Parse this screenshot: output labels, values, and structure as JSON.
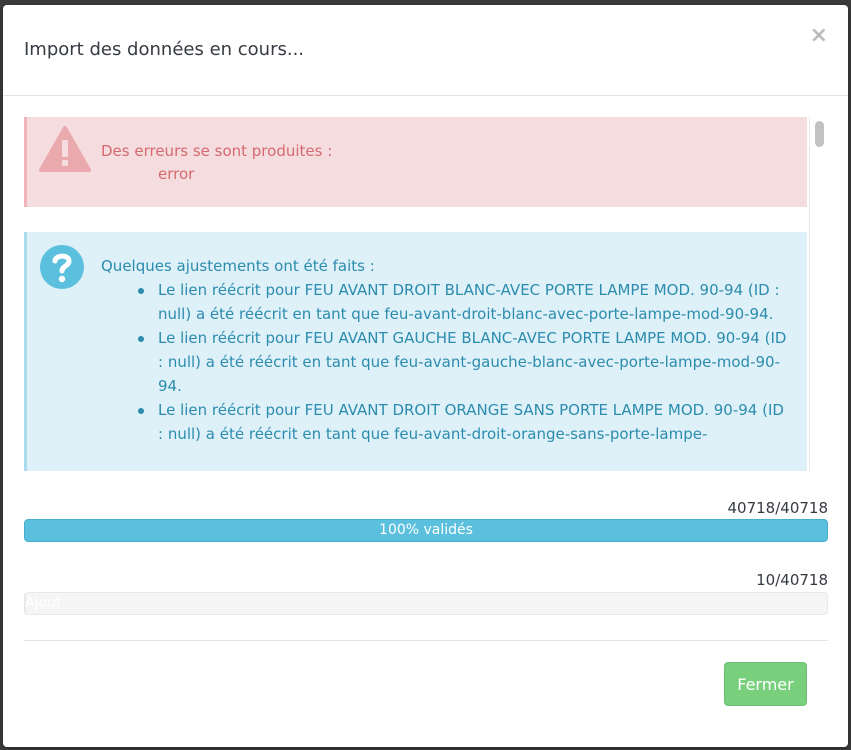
{
  "modal": {
    "title": "Import des données en cours...",
    "close_glyph": "×"
  },
  "errors": {
    "title": "Des erreurs se sont produites :",
    "message": "error",
    "icon": "warning-triangle-icon",
    "color": "#d56a70"
  },
  "adjustments": {
    "title": "Quelques ajustements ont été faits :",
    "icon": "question-circle-icon",
    "color": "#2b8cae",
    "items": [
      "Le lien réécrit pour FEU AVANT DROIT BLANC-AVEC PORTE LAMPE MOD. 90-94 (ID : null) a été réécrit en tant que feu-avant-droit-blanc-avec-porte-lampe-mod-90-94.",
      "Le lien réécrit pour FEU AVANT GAUCHE BLANC-AVEC PORTE LAMPE MOD. 90-94 (ID : null) a été réécrit en tant que feu-avant-gauche-blanc-avec-porte-lampe-mod-90-94.",
      "Le lien réécrit pour FEU AVANT DROIT ORANGE SANS PORTE LAMPE MOD. 90-94 (ID : null) a été réécrit en tant que feu-avant-droit-orange-sans-porte-lampe-"
    ]
  },
  "validation": {
    "count": "40718/40718",
    "label": "100% validés",
    "progress": 1.0,
    "color": "#5bc0de"
  },
  "import": {
    "count": "10/40718",
    "label": "Ajout",
    "progress": 0.000246
  },
  "footer": {
    "close_label": "Fermer",
    "button_color": "#78d07d"
  }
}
